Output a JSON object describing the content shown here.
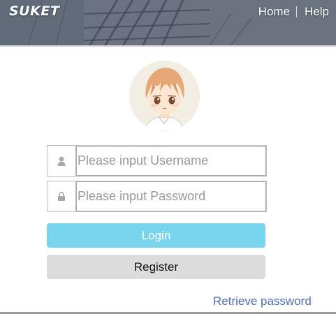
{
  "header": {
    "logo_text": "SUKET",
    "nav": {
      "home": "Home",
      "help": "Help"
    }
  },
  "avatar": {
    "icon": "anime-character-avatar"
  },
  "form": {
    "username": {
      "placeholder": "Please input Username",
      "value": "",
      "icon": "user-icon"
    },
    "password": {
      "placeholder": "Please input Password",
      "value": "",
      "icon": "lock-icon"
    },
    "login_label": "Login",
    "register_label": "Register",
    "retrieve_label": "Retrieve password"
  },
  "colors": {
    "login_button": "#79d4ee",
    "register_button": "#dcdcdc",
    "link": "#4d6fae",
    "header_overlay": "#5b6270"
  }
}
